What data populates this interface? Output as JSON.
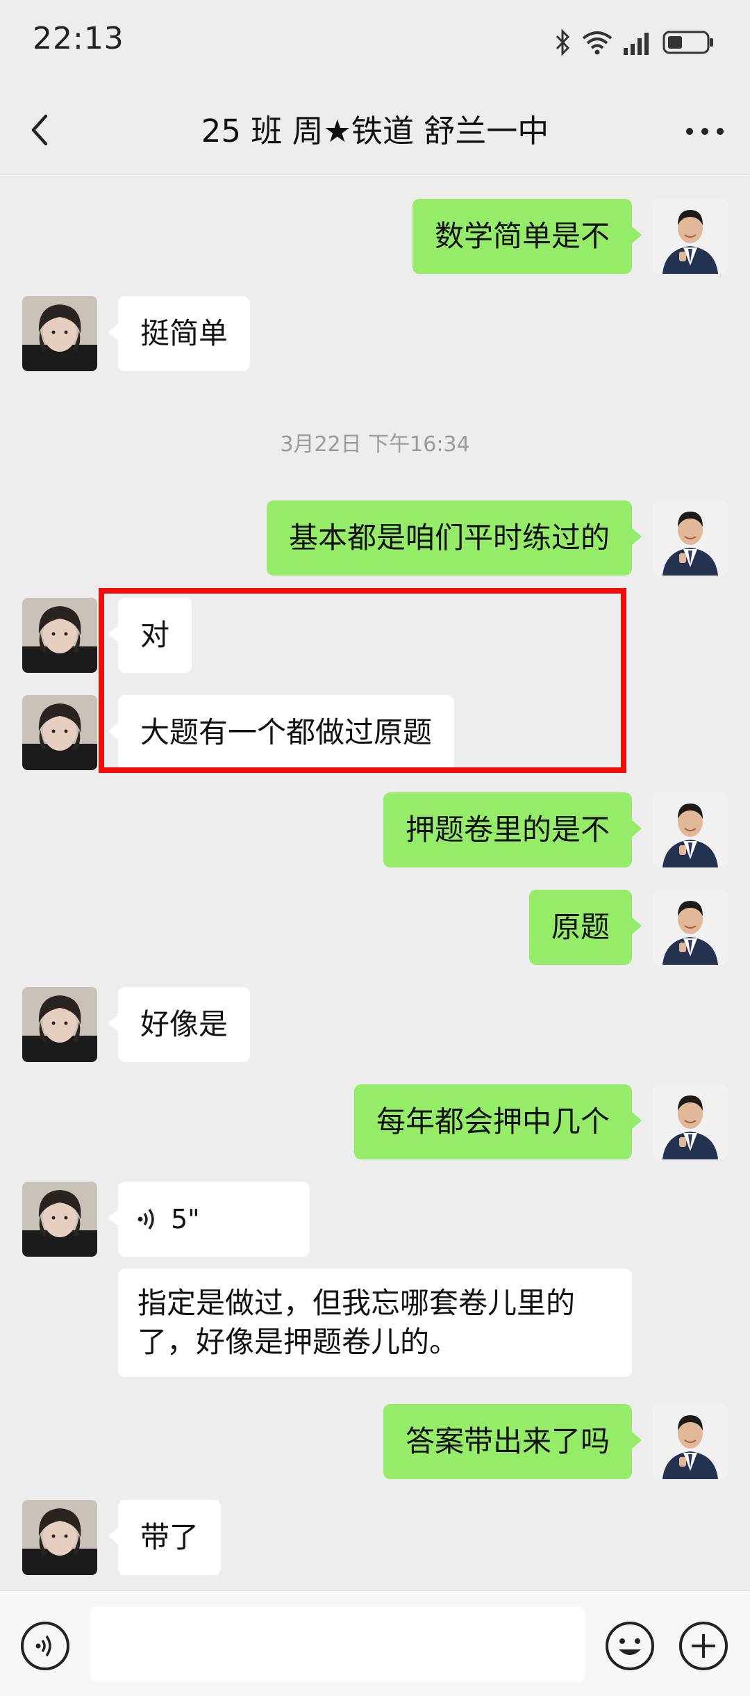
{
  "status": {
    "time": "22:13"
  },
  "header": {
    "title": "25 班 周★铁道  舒兰一中"
  },
  "messages": {
    "m1": "数学简单是不",
    "m2": "挺简单",
    "m3": "基本都是咱们平时练过的",
    "m4": "对",
    "m5": "大题有一个都做过原题",
    "m6": "押题卷里的是不",
    "m7": "原题",
    "m8": "好像是",
    "m9": "每年都会押中几个",
    "m10": "指定是做过，但我忘哪套卷儿里的了，好像是押题卷儿的。",
    "m11": "答案带出来了吗",
    "m12": "带了"
  },
  "timestamp": "3月22日 下午16:34",
  "voice": {
    "duration": "5\""
  },
  "colors": {
    "sent_bubble": "#95ec69",
    "received_bubble": "#ffffff",
    "highlight": "#f20d0d",
    "background": "#ededed"
  },
  "icons": {
    "back": "chevron-left-icon",
    "more": "more-dots-icon",
    "voice": "voice-wave-icon",
    "emoji": "emoji-icon",
    "plus": "plus-icon"
  }
}
